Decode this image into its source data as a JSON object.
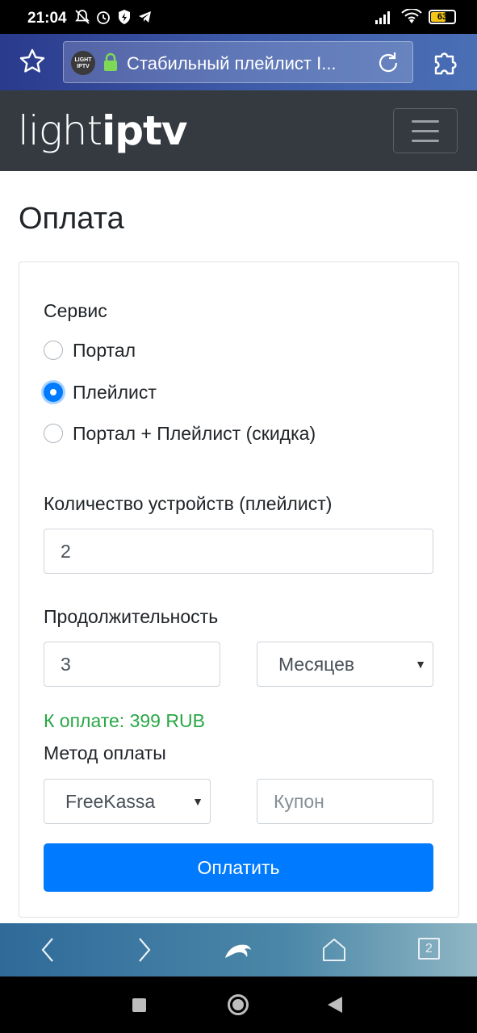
{
  "status_bar": {
    "time": "21:04",
    "battery_level": "63",
    "icons_left": [
      "mute-icon",
      "alarm-icon",
      "data-saver-icon",
      "telegram-icon"
    ],
    "icons_right": [
      "signal-icon",
      "wifi-icon",
      "battery-icon"
    ]
  },
  "browser": {
    "favicon_text": "LIGHT IPTV",
    "url_title": "Стабильный плейлист I...",
    "tab_count": "2"
  },
  "navbar": {
    "brand_light": "light",
    "brand_iptv": "iptv"
  },
  "page": {
    "title": "Оплата"
  },
  "form": {
    "service_label": "Сервис",
    "service_options": [
      {
        "label": "Портал",
        "checked": false
      },
      {
        "label": "Плейлист",
        "checked": true
      },
      {
        "label": "Портал + Плейлист (скидка)",
        "checked": false
      }
    ],
    "devices_label": "Количество устройств (плейлист)",
    "devices_value": "2",
    "duration_label": "Продолжительность",
    "duration_value": "3",
    "duration_unit": "Месяцев",
    "price_text": "К оплате: 399 RUB",
    "payment_label": "Метод оплаты",
    "payment_method": "FreeKassa",
    "coupon_placeholder": "Купон",
    "submit_label": "Оплатить"
  },
  "colors": {
    "primary": "#007bff",
    "success": "#28a745",
    "navbar_bg": "#343a40"
  }
}
